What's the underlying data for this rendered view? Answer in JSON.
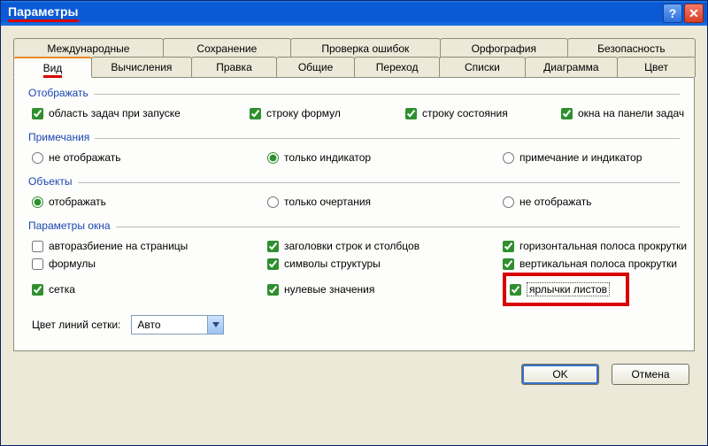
{
  "window": {
    "title": "Параметры"
  },
  "tabs": {
    "row1": [
      {
        "label": "Международные"
      },
      {
        "label": "Сохранение"
      },
      {
        "label": "Проверка ошибок"
      },
      {
        "label": "Орфография"
      },
      {
        "label": "Безопасность"
      }
    ],
    "row2": [
      {
        "label": "Вид",
        "active": true
      },
      {
        "label": "Вычисления"
      },
      {
        "label": "Правка"
      },
      {
        "label": "Общие"
      },
      {
        "label": "Переход"
      },
      {
        "label": "Списки"
      },
      {
        "label": "Диаграмма"
      },
      {
        "label": "Цвет"
      }
    ]
  },
  "groups": {
    "display": {
      "title": "Отображать",
      "opts": {
        "taskpane": "область задач при запуске",
        "formula_bar": "строку формул",
        "status_bar": "строку состояния",
        "taskbar_windows": "окна на панели задач"
      }
    },
    "comments": {
      "title": "Примечания",
      "opts": {
        "none": "не отображать",
        "indicator": "только индикатор",
        "full": "примечание и индикатор"
      }
    },
    "objects": {
      "title": "Объекты",
      "opts": {
        "show": "отображать",
        "placeholders": "только очертания",
        "hide": "не отображать"
      }
    },
    "window_opts": {
      "title": "Параметры окна",
      "opts": {
        "page_breaks": "авторазбиение на страницы",
        "headers": "заголовки строк и столбцов",
        "hscroll": "горизонтальная полоса прокрутки",
        "formulas": "формулы",
        "outline": "символы структуры",
        "vscroll": "вертикальная полоса прокрутки",
        "gridlines": "сетка",
        "zeros": "нулевые значения",
        "sheet_tabs": "ярлычки листов"
      },
      "grid_color_label": "Цвет линий сетки:",
      "grid_color_value": "Авто"
    }
  },
  "buttons": {
    "ok": "OK",
    "cancel": "Отмена"
  }
}
